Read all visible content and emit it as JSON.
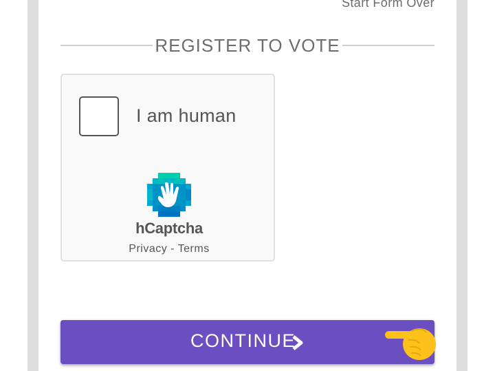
{
  "header": {
    "start_over_label": "Start Form Over"
  },
  "form": {
    "title": "REGISTER TO VOTE"
  },
  "captcha": {
    "checkbox_label": "I am human",
    "brand": "hCaptcha",
    "privacy_label": "Privacy",
    "separator": "-",
    "terms_label": "Terms",
    "logo_icon": "hcaptcha-hand-logo",
    "logo_colors": [
      "#0074bf",
      "#00b0d0",
      "#00cfb0"
    ]
  },
  "actions": {
    "continue_label": "CONTINUE",
    "continue_icon": "chevron-right-icon",
    "pointer_icon": "pointing-hand-icon",
    "button_color": "#6b4fc1"
  }
}
